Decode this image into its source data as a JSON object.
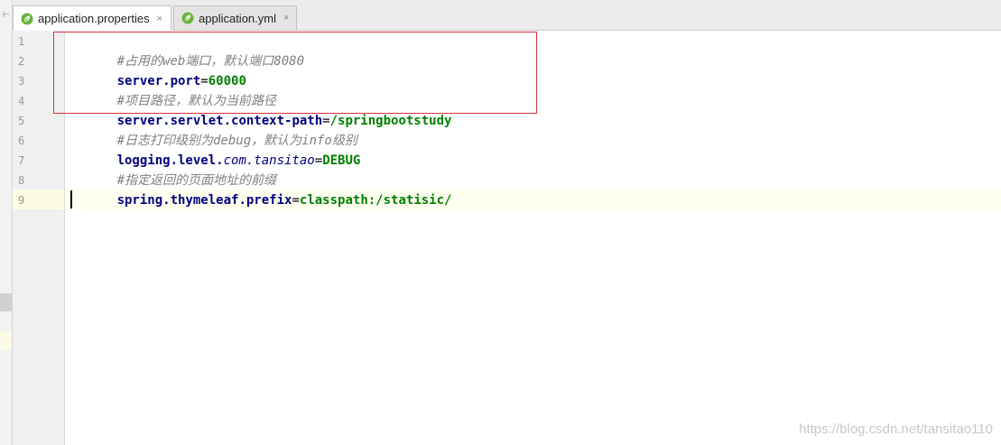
{
  "tabs": [
    {
      "label": "application.properties",
      "active": true,
      "icon": "spring-leaf-icon"
    },
    {
      "label": "application.yml",
      "active": false,
      "icon": "spring-leaf-icon"
    }
  ],
  "tab_close_glyph": "×",
  "line_numbers": [
    "1",
    "2",
    "3",
    "4",
    "5",
    "6",
    "7",
    "8",
    "9"
  ],
  "current_line": "9",
  "code": {
    "l1": {
      "comment": "#占用的web端口，默认端口8080"
    },
    "l2": {
      "key": "server.port",
      "eq": "=",
      "value": "60000"
    },
    "l3": {
      "comment": "#项目路径，默认为当前路径"
    },
    "l4": {
      "key": "server.servlet.context-path",
      "eq": "=",
      "value": "/springbootstudy"
    },
    "l5": {
      "comment": "#日志打印级别为debug，默认为info级别"
    },
    "l6": {
      "key_a": "logging.level.",
      "key_b": "com.tansitao",
      "eq": "=",
      "value": "DEBUG"
    },
    "l7": {
      "comment": "#指定返回的页面地址的前缀"
    },
    "l8": {
      "key": "spring.thymeleaf.prefix",
      "eq": "=",
      "value": "classpath:/statisic/"
    }
  },
  "edge_mark": "⊢",
  "watermark": "https://blog.csdn.net/tansitao110",
  "colors": {
    "comment": "#808080",
    "key": "#000080",
    "value": "#008000",
    "highlight_box": "#d9323c",
    "leaf_icon": "#6db33f"
  }
}
